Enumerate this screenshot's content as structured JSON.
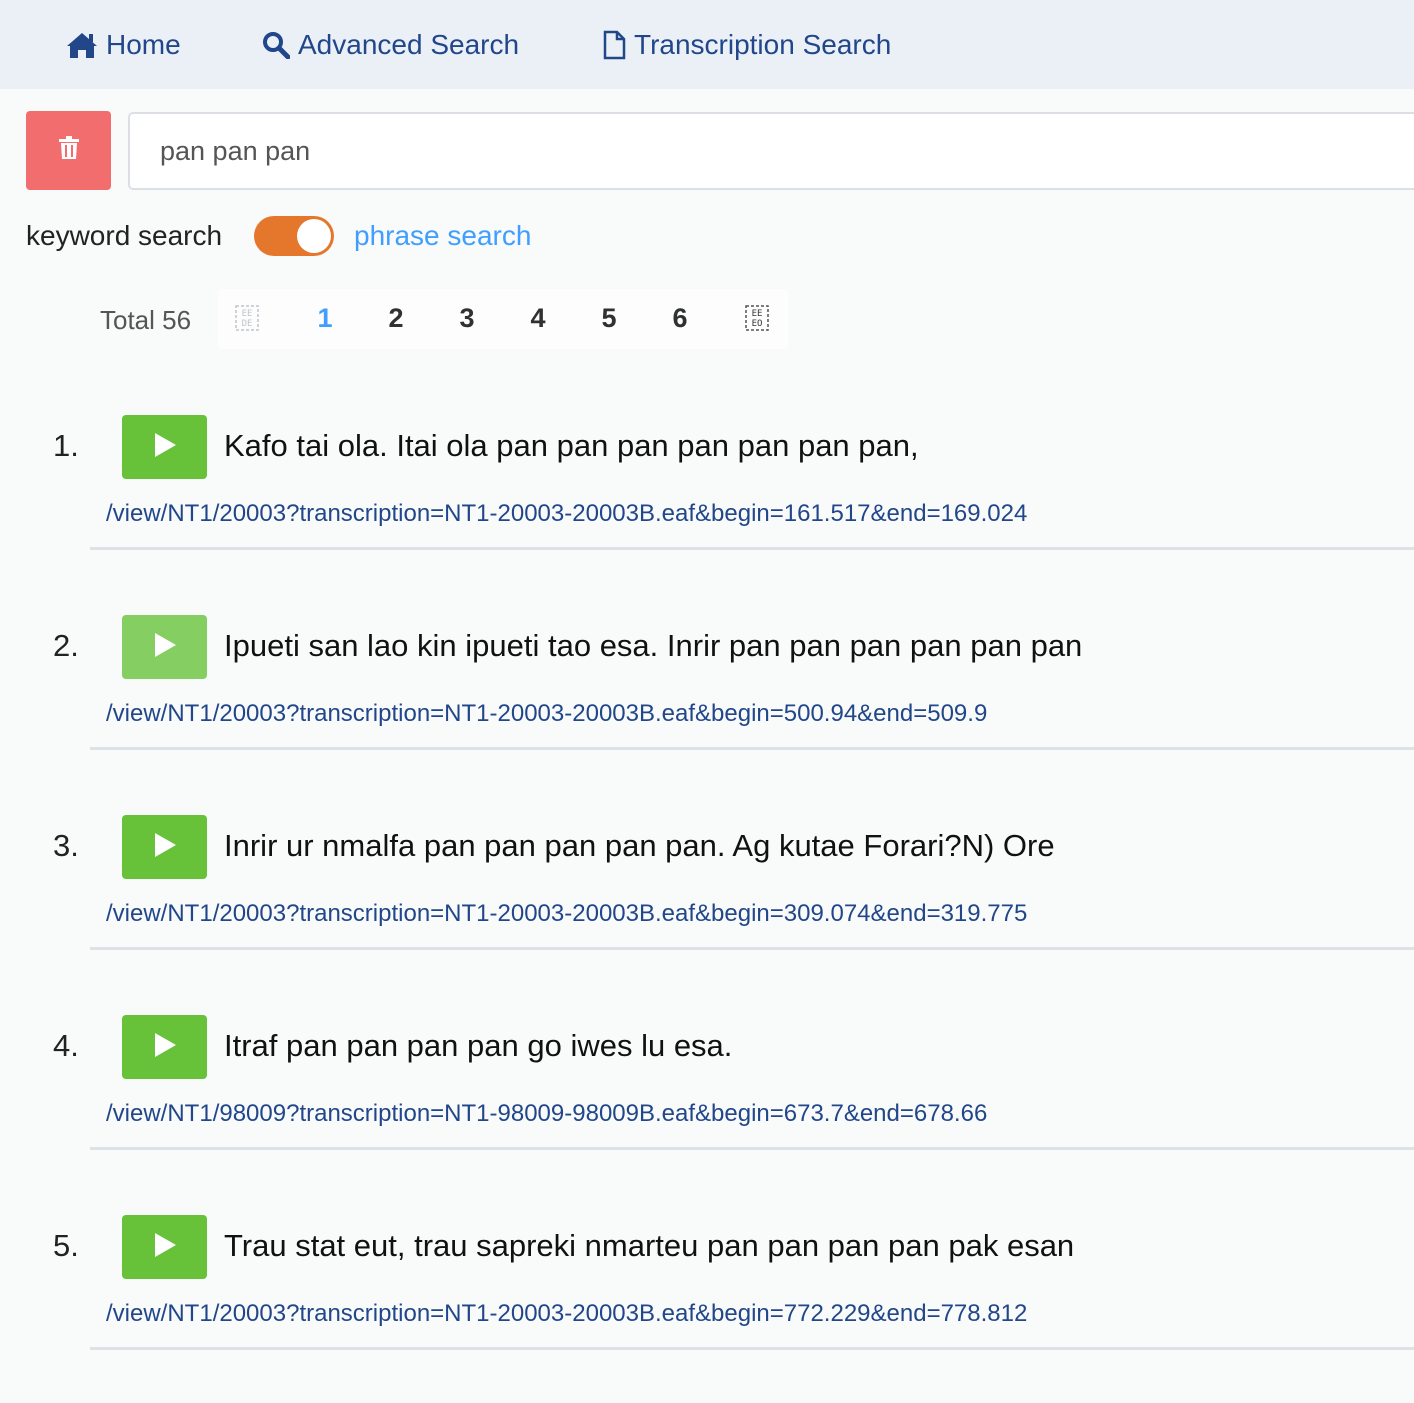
{
  "nav": {
    "home_label": "Home",
    "advanced_label": "Advanced Search",
    "transcription_label": "Transcription Search"
  },
  "search": {
    "query": "pan pan pan"
  },
  "mode": {
    "keyword_label": "keyword search",
    "phrase_label": "phrase search",
    "phrase_enabled": true,
    "toggle_color": "#e5772c"
  },
  "pagination": {
    "total_label": "Total 56",
    "pages": [
      "1",
      "2",
      "3",
      "4",
      "5",
      "6"
    ],
    "current_page": "1"
  },
  "results": [
    {
      "number": "1.",
      "text": "Kafo tai ola. Itai ola pan pan pan pan pan pan pan,",
      "link": "/view/NT1/20003?transcription=NT1-20003-20003B.eaf&begin=161.517&end=169.024"
    },
    {
      "number": "2.",
      "text": "Ipueti san lao kin ipueti tao esa. Inrir pan pan pan pan pan pan",
      "link": "/view/NT1/20003?transcription=NT1-20003-20003B.eaf&begin=500.94&end=509.9"
    },
    {
      "number": "3.",
      "text": "Inrir ur nmalfa pan pan pan pan pan. Ag kutae Forari?N) Ore",
      "link": "/view/NT1/20003?transcription=NT1-20003-20003B.eaf&begin=309.074&end=319.775"
    },
    {
      "number": "4.",
      "text": "Itraf pan pan pan pan go iwes lu esa.",
      "link": "/view/NT1/98009?transcription=NT1-98009-98009B.eaf&begin=673.7&end=678.66"
    },
    {
      "number": "5.",
      "text": "Trau stat eut, trau sapreki nmarteu pan pan pan pan pak esan",
      "link": "/view/NT1/20003?transcription=NT1-20003-20003B.eaf&begin=772.229&end=778.812"
    }
  ],
  "colors": {
    "nav_bg": "#ebf0f7",
    "nav_text": "#21478a",
    "delete_button": "#f26d6d",
    "play_button": "#67c23a",
    "link": "#21478a",
    "active_page": "#409eff"
  },
  "icons": {
    "home": "home-icon",
    "advanced": "search-icon",
    "transcription": "document-icon",
    "delete": "trash-icon",
    "play": "play-icon",
    "prev": "prev-page-icon",
    "next": "next-page-icon"
  }
}
